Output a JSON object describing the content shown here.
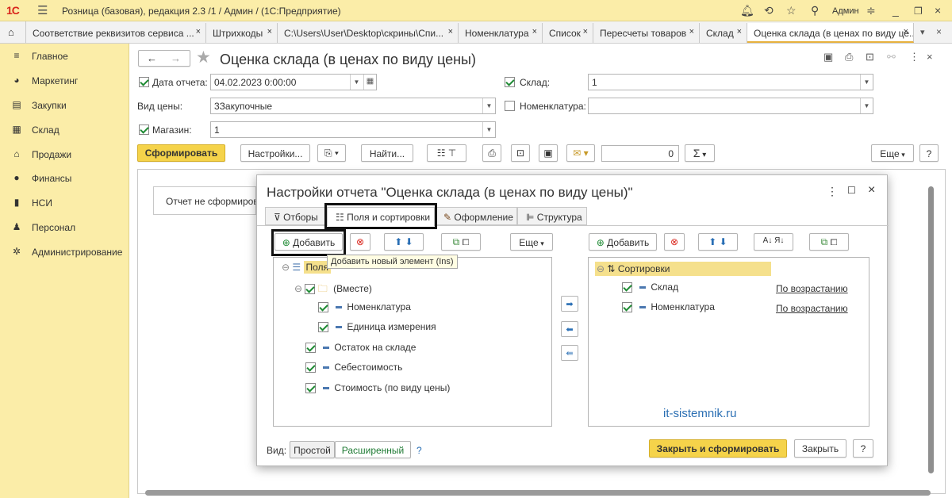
{
  "titlebar": {
    "logo": "1C",
    "title": "Розница (базовая), редакция 2.3 /1 / Админ /  (1С:Предприятие)",
    "user": "Админ"
  },
  "tabs": [
    {
      "label": "Соответствие реквизитов сервиса ...",
      "close": "×"
    },
    {
      "label": "Штрихкоды",
      "close": "×"
    },
    {
      "label": "C:\\Users\\User\\Desktop\\скрины\\Спи...",
      "close": "×"
    },
    {
      "label": "Номенклатура",
      "close": "×"
    },
    {
      "label": "Список",
      "close": "×"
    },
    {
      "label": "Пересчеты товаров",
      "close": "×"
    },
    {
      "label": "Склад",
      "close": "×"
    },
    {
      "label": "Оценка склада (в ценах по виду це...",
      "close": "×"
    }
  ],
  "sidebar": {
    "items": [
      {
        "label": "Главное",
        "icon": "≡"
      },
      {
        "label": "Маркетинг",
        "icon": "◕"
      },
      {
        "label": "Закупки",
        "icon": "▤"
      },
      {
        "label": "Склад",
        "icon": "▦"
      },
      {
        "label": "Продажи",
        "icon": "⌂"
      },
      {
        "label": "Финансы",
        "icon": "●"
      },
      {
        "label": "НСИ",
        "icon": "▮"
      },
      {
        "label": "Персонал",
        "icon": "♟"
      },
      {
        "label": "Администрирование",
        "icon": "✲"
      }
    ]
  },
  "form": {
    "title": "Оценка склада (в ценах по виду цены)",
    "report_date_label": "Дата отчета:",
    "report_date_value": "04.02.2023  0:00:00",
    "warehouse_label": "Склад:",
    "warehouse_value": "1",
    "price_type_label": "Вид цены:",
    "price_type_value": "3Закупочные",
    "nomenclature_label": "Номенклатура:",
    "nomenclature_value": "",
    "store_label": "Магазин:",
    "store_value": "1",
    "generate": "Сформировать",
    "settings": "Настройки...",
    "find": "Найти...",
    "number_value": "0",
    "sum_symbol": "Σ",
    "more": "Еще",
    "help": "?",
    "not_generated": "Отчет не сформирован"
  },
  "dialog": {
    "title": "Настройки отчета \"Оценка склада (в ценах по виду цены)\"",
    "tabs": [
      "Отборы",
      "Поля и сортировки",
      "Оформление",
      "Структура"
    ],
    "add": "Добавить",
    "more": "Еще",
    "tooltip": "Добавить новый элемент (Ins)",
    "left_tree": {
      "root": "Поля",
      "group": "(Вместе)",
      "items": [
        "Номенклатура",
        "Единица измерения",
        "Остаток на складе",
        "Себестоимость",
        "Стоимость (по виду цены)"
      ]
    },
    "right_tree": {
      "root": "Сортировки",
      "items": [
        {
          "label": "Склад",
          "order": "По возрастанию"
        },
        {
          "label": "Номенклатура",
          "order": "По возрастанию"
        }
      ]
    },
    "view_label": "Вид:",
    "view_simple": "Простой",
    "view_extended": "Расширенный",
    "view_help": "?",
    "close_generate": "Закрыть и сформировать",
    "close": "Закрыть",
    "help": "?"
  },
  "watermark": "it-sistemnik.ru"
}
